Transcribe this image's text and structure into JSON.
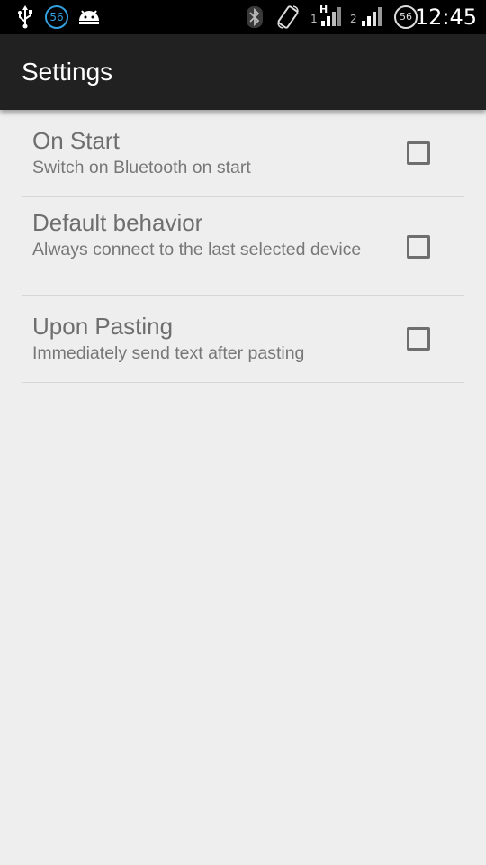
{
  "status_bar": {
    "time": "12:45",
    "notif_badge_blue": "56",
    "battery_badge": "56",
    "sim1_label": "1",
    "sim1_network": "H",
    "sim2_label": "2",
    "icons": [
      "usb-icon",
      "android-debug-icon",
      "bluetooth-icon",
      "screen-rotation-icon",
      "signal-icon"
    ]
  },
  "action_bar": {
    "title": "Settings"
  },
  "preferences": [
    {
      "title": "On Start",
      "summary": "Switch on Bluetooth on start",
      "checked": false
    },
    {
      "title": "Default behavior",
      "summary": "Always connect to the last selected device",
      "checked": false
    },
    {
      "title": "Upon Pasting",
      "summary": "Immediately send text after pasting",
      "checked": false
    }
  ],
  "colors": {
    "background": "#eeeeee",
    "action_bar": "#212121",
    "status_bar": "#000000",
    "text_primary": "#6e6e6e",
    "divider": "#d6d6d6"
  }
}
